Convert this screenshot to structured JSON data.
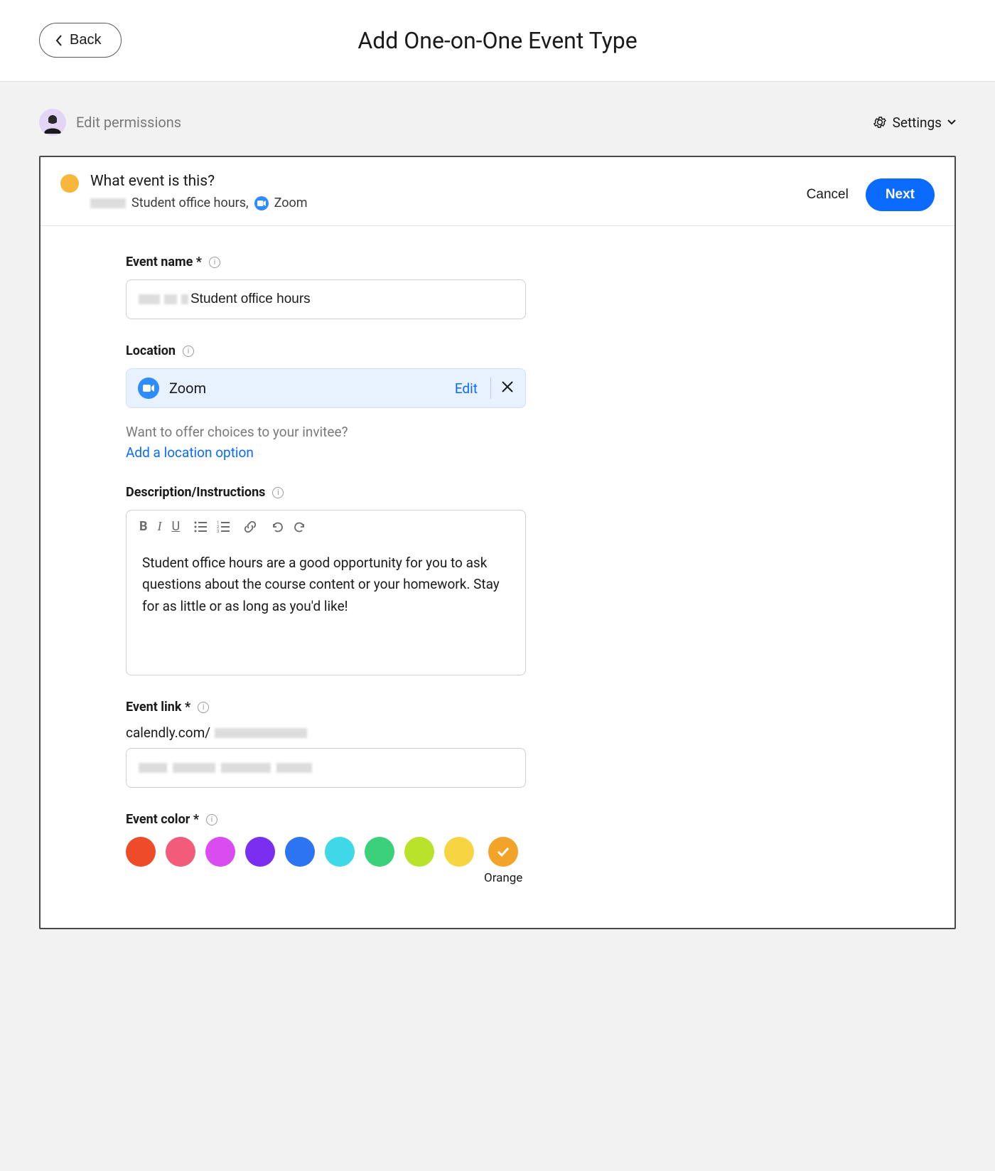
{
  "topbar": {
    "back_label": "Back",
    "title": "Add One-on-One Event Type"
  },
  "permissions": {
    "edit_label": "Edit permissions",
    "settings_label": "Settings"
  },
  "card": {
    "header": {
      "title": "What event is this?",
      "summary_text": "Student office hours,",
      "summary_location": "Zoom",
      "cancel_label": "Cancel",
      "next_label": "Next"
    },
    "event_name": {
      "label": "Event name",
      "value": "Student office hours"
    },
    "location": {
      "label": "Location",
      "selected": "Zoom",
      "edit_label": "Edit",
      "hint": "Want to offer choices to your invitee?",
      "add_label": "Add a location option"
    },
    "description": {
      "label": "Description/Instructions",
      "value": "Student office hours are a good opportunity for you to ask questions about the course content or your homework. Stay for as little or as long as you'd like!"
    },
    "event_link": {
      "label": "Event link",
      "prefix": "calendly.com/"
    },
    "event_color": {
      "label": "Event color",
      "options": [
        {
          "name": "red",
          "hex": "#ee4b2b"
        },
        {
          "name": "pink",
          "hex": "#f25b7a"
        },
        {
          "name": "magenta",
          "hex": "#d94cf0"
        },
        {
          "name": "violet",
          "hex": "#7a2ef0"
        },
        {
          "name": "blue",
          "hex": "#2c74f2"
        },
        {
          "name": "cyan",
          "hex": "#3fd8e8"
        },
        {
          "name": "green",
          "hex": "#3bd07a"
        },
        {
          "name": "lime",
          "hex": "#b9e22a"
        },
        {
          "name": "yellow",
          "hex": "#f7d542"
        },
        {
          "name": "orange",
          "hex": "#f2a32a"
        }
      ],
      "selected_index": 9,
      "selected_label": "Orange"
    }
  },
  "colors": {
    "accent": "#0b6bff",
    "header_dot": "#f6b73c"
  }
}
